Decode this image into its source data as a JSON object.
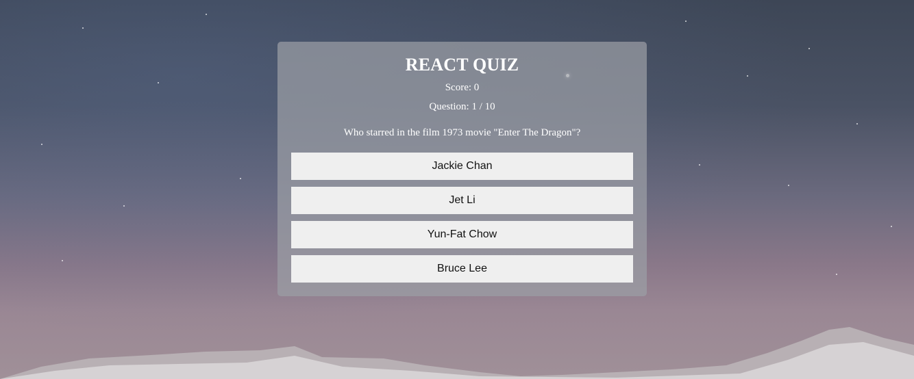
{
  "quiz": {
    "title": "REACT QUIZ",
    "score_text": "Score: 0",
    "question_count_text": "Question: 1 / 10",
    "question": "Who starred in the film 1973 movie \"Enter The Dragon\"?",
    "answers": [
      {
        "label": "Jackie Chan"
      },
      {
        "label": "Jet Li"
      },
      {
        "label": "Yun-Fat Chow"
      },
      {
        "label": "Bruce Lee"
      }
    ]
  },
  "colors": {
    "button_background": "#efefef",
    "text_on_card": "#ffffff"
  }
}
